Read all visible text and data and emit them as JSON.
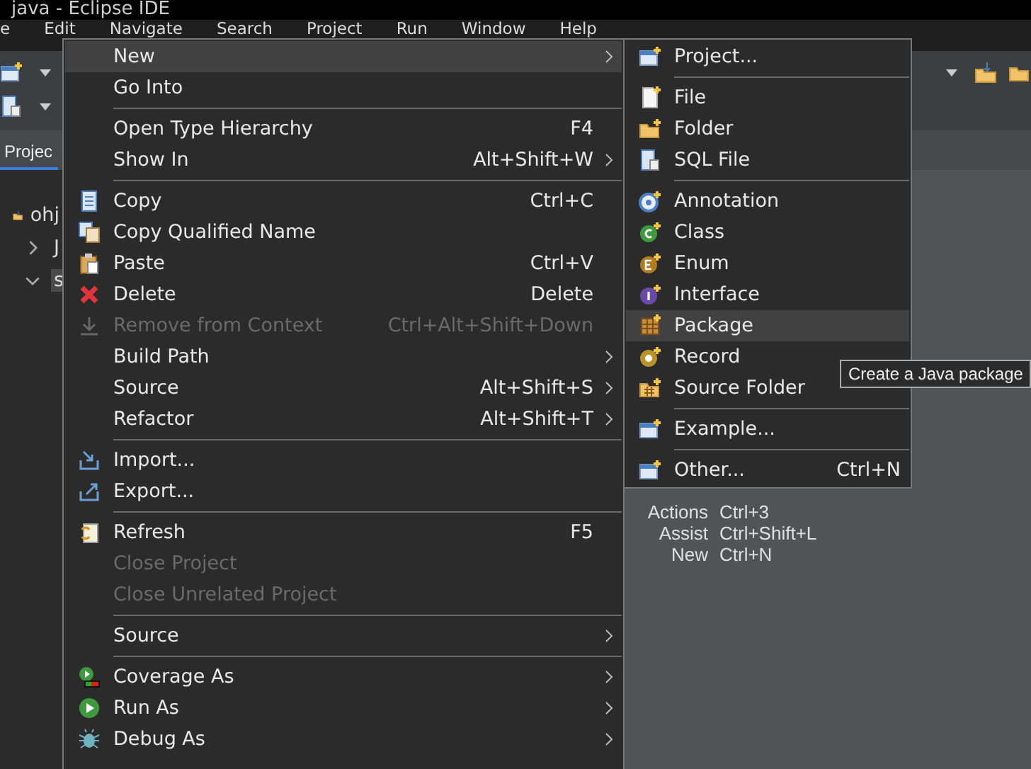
{
  "window": {
    "title": "java - Eclipse IDE"
  },
  "menu_bar": [
    "e",
    "Edit",
    "Navigate",
    "Search",
    "Project",
    "Run",
    "Window",
    "Help"
  ],
  "view_tab": {
    "label": "Projec",
    "selected": true
  },
  "tree": [
    {
      "label": "ohj",
      "selected": false,
      "children": [
        {
          "label": "J",
          "selected": false,
          "expanded": false
        },
        {
          "label": "s",
          "selected": true,
          "expanded": true
        }
      ]
    }
  ],
  "hint_rows": [
    {
      "label": "Actions",
      "shortcut": "Ctrl+3"
    },
    {
      "label": "Assist",
      "shortcut": "Ctrl+Shift+L"
    },
    {
      "label": "New",
      "shortcut": "Ctrl+N"
    }
  ],
  "context_menu": {
    "items": [
      {
        "kind": "item",
        "label": "New",
        "submenu": true,
        "disabled": false,
        "selected": true
      },
      {
        "kind": "item",
        "label": "Go Into",
        "submenu": false,
        "disabled": false,
        "selected": false
      },
      {
        "kind": "separator"
      },
      {
        "kind": "item",
        "label": "Open Type Hierarchy",
        "shortcut": "F4",
        "submenu": false,
        "disabled": false,
        "selected": false
      },
      {
        "kind": "item",
        "label": "Show In",
        "shortcut": "Alt+Shift+W",
        "submenu": true,
        "disabled": false,
        "selected": false
      },
      {
        "kind": "separator"
      },
      {
        "kind": "item",
        "label": "Copy",
        "shortcut": "Ctrl+C",
        "submenu": false,
        "disabled": false,
        "selected": false
      },
      {
        "kind": "item",
        "label": "Copy Qualified Name",
        "submenu": false,
        "disabled": false,
        "selected": false
      },
      {
        "kind": "item",
        "label": "Paste",
        "shortcut": "Ctrl+V",
        "submenu": false,
        "disabled": false,
        "selected": false
      },
      {
        "kind": "item",
        "label": "Delete",
        "shortcut": "Delete",
        "submenu": false,
        "disabled": false,
        "selected": false
      },
      {
        "kind": "item",
        "label": "Remove from Context",
        "shortcut": "Ctrl+Alt+Shift+Down",
        "submenu": false,
        "disabled": true,
        "selected": false
      },
      {
        "kind": "item",
        "label": "Build Path",
        "submenu": true,
        "disabled": false,
        "selected": false
      },
      {
        "kind": "item",
        "label": "Source",
        "shortcut": "Alt+Shift+S",
        "submenu": true,
        "disabled": false,
        "selected": false
      },
      {
        "kind": "item",
        "label": "Refactor",
        "shortcut": "Alt+Shift+T",
        "submenu": true,
        "disabled": false,
        "selected": false
      },
      {
        "kind": "separator"
      },
      {
        "kind": "item",
        "label": "Import...",
        "submenu": false,
        "disabled": false,
        "selected": false
      },
      {
        "kind": "item",
        "label": "Export...",
        "submenu": false,
        "disabled": false,
        "selected": false
      },
      {
        "kind": "separator"
      },
      {
        "kind": "item",
        "label": "Refresh",
        "shortcut": "F5",
        "submenu": false,
        "disabled": false,
        "selected": false
      },
      {
        "kind": "item",
        "label": "Close Project",
        "submenu": false,
        "disabled": true,
        "selected": false
      },
      {
        "kind": "item",
        "label": "Close Unrelated Project",
        "submenu": false,
        "disabled": true,
        "selected": false
      },
      {
        "kind": "separator"
      },
      {
        "kind": "item",
        "label": "Source",
        "submenu": true,
        "disabled": false,
        "selected": false
      },
      {
        "kind": "separator"
      },
      {
        "kind": "item",
        "label": "Coverage As",
        "submenu": true,
        "disabled": false,
        "selected": false
      },
      {
        "kind": "item",
        "label": "Run As",
        "submenu": true,
        "disabled": false,
        "selected": false
      },
      {
        "kind": "item",
        "label": "Debug As",
        "submenu": true,
        "disabled": false,
        "selected": false
      }
    ]
  },
  "new_submenu": {
    "items": [
      {
        "kind": "item",
        "label": "Project...",
        "selected": false
      },
      {
        "kind": "separator"
      },
      {
        "kind": "item",
        "label": "File",
        "selected": false
      },
      {
        "kind": "item",
        "label": "Folder",
        "selected": false
      },
      {
        "kind": "item",
        "label": "SQL File",
        "selected": false
      },
      {
        "kind": "separator"
      },
      {
        "kind": "item",
        "label": "Annotation",
        "selected": false
      },
      {
        "kind": "item",
        "label": "Class",
        "selected": false
      },
      {
        "kind": "item",
        "label": "Enum",
        "selected": false
      },
      {
        "kind": "item",
        "label": "Interface",
        "selected": false
      },
      {
        "kind": "item",
        "label": "Package",
        "selected": true
      },
      {
        "kind": "item",
        "label": "Record",
        "selected": false
      },
      {
        "kind": "item",
        "label": "Source Folder",
        "selected": false
      },
      {
        "kind": "separator"
      },
      {
        "kind": "item",
        "label": "Example...",
        "selected": false
      },
      {
        "kind": "separator"
      },
      {
        "kind": "item",
        "label": "Other...",
        "shortcut": "Ctrl+N",
        "selected": false
      }
    ]
  },
  "tooltip": "Create a Java package"
}
